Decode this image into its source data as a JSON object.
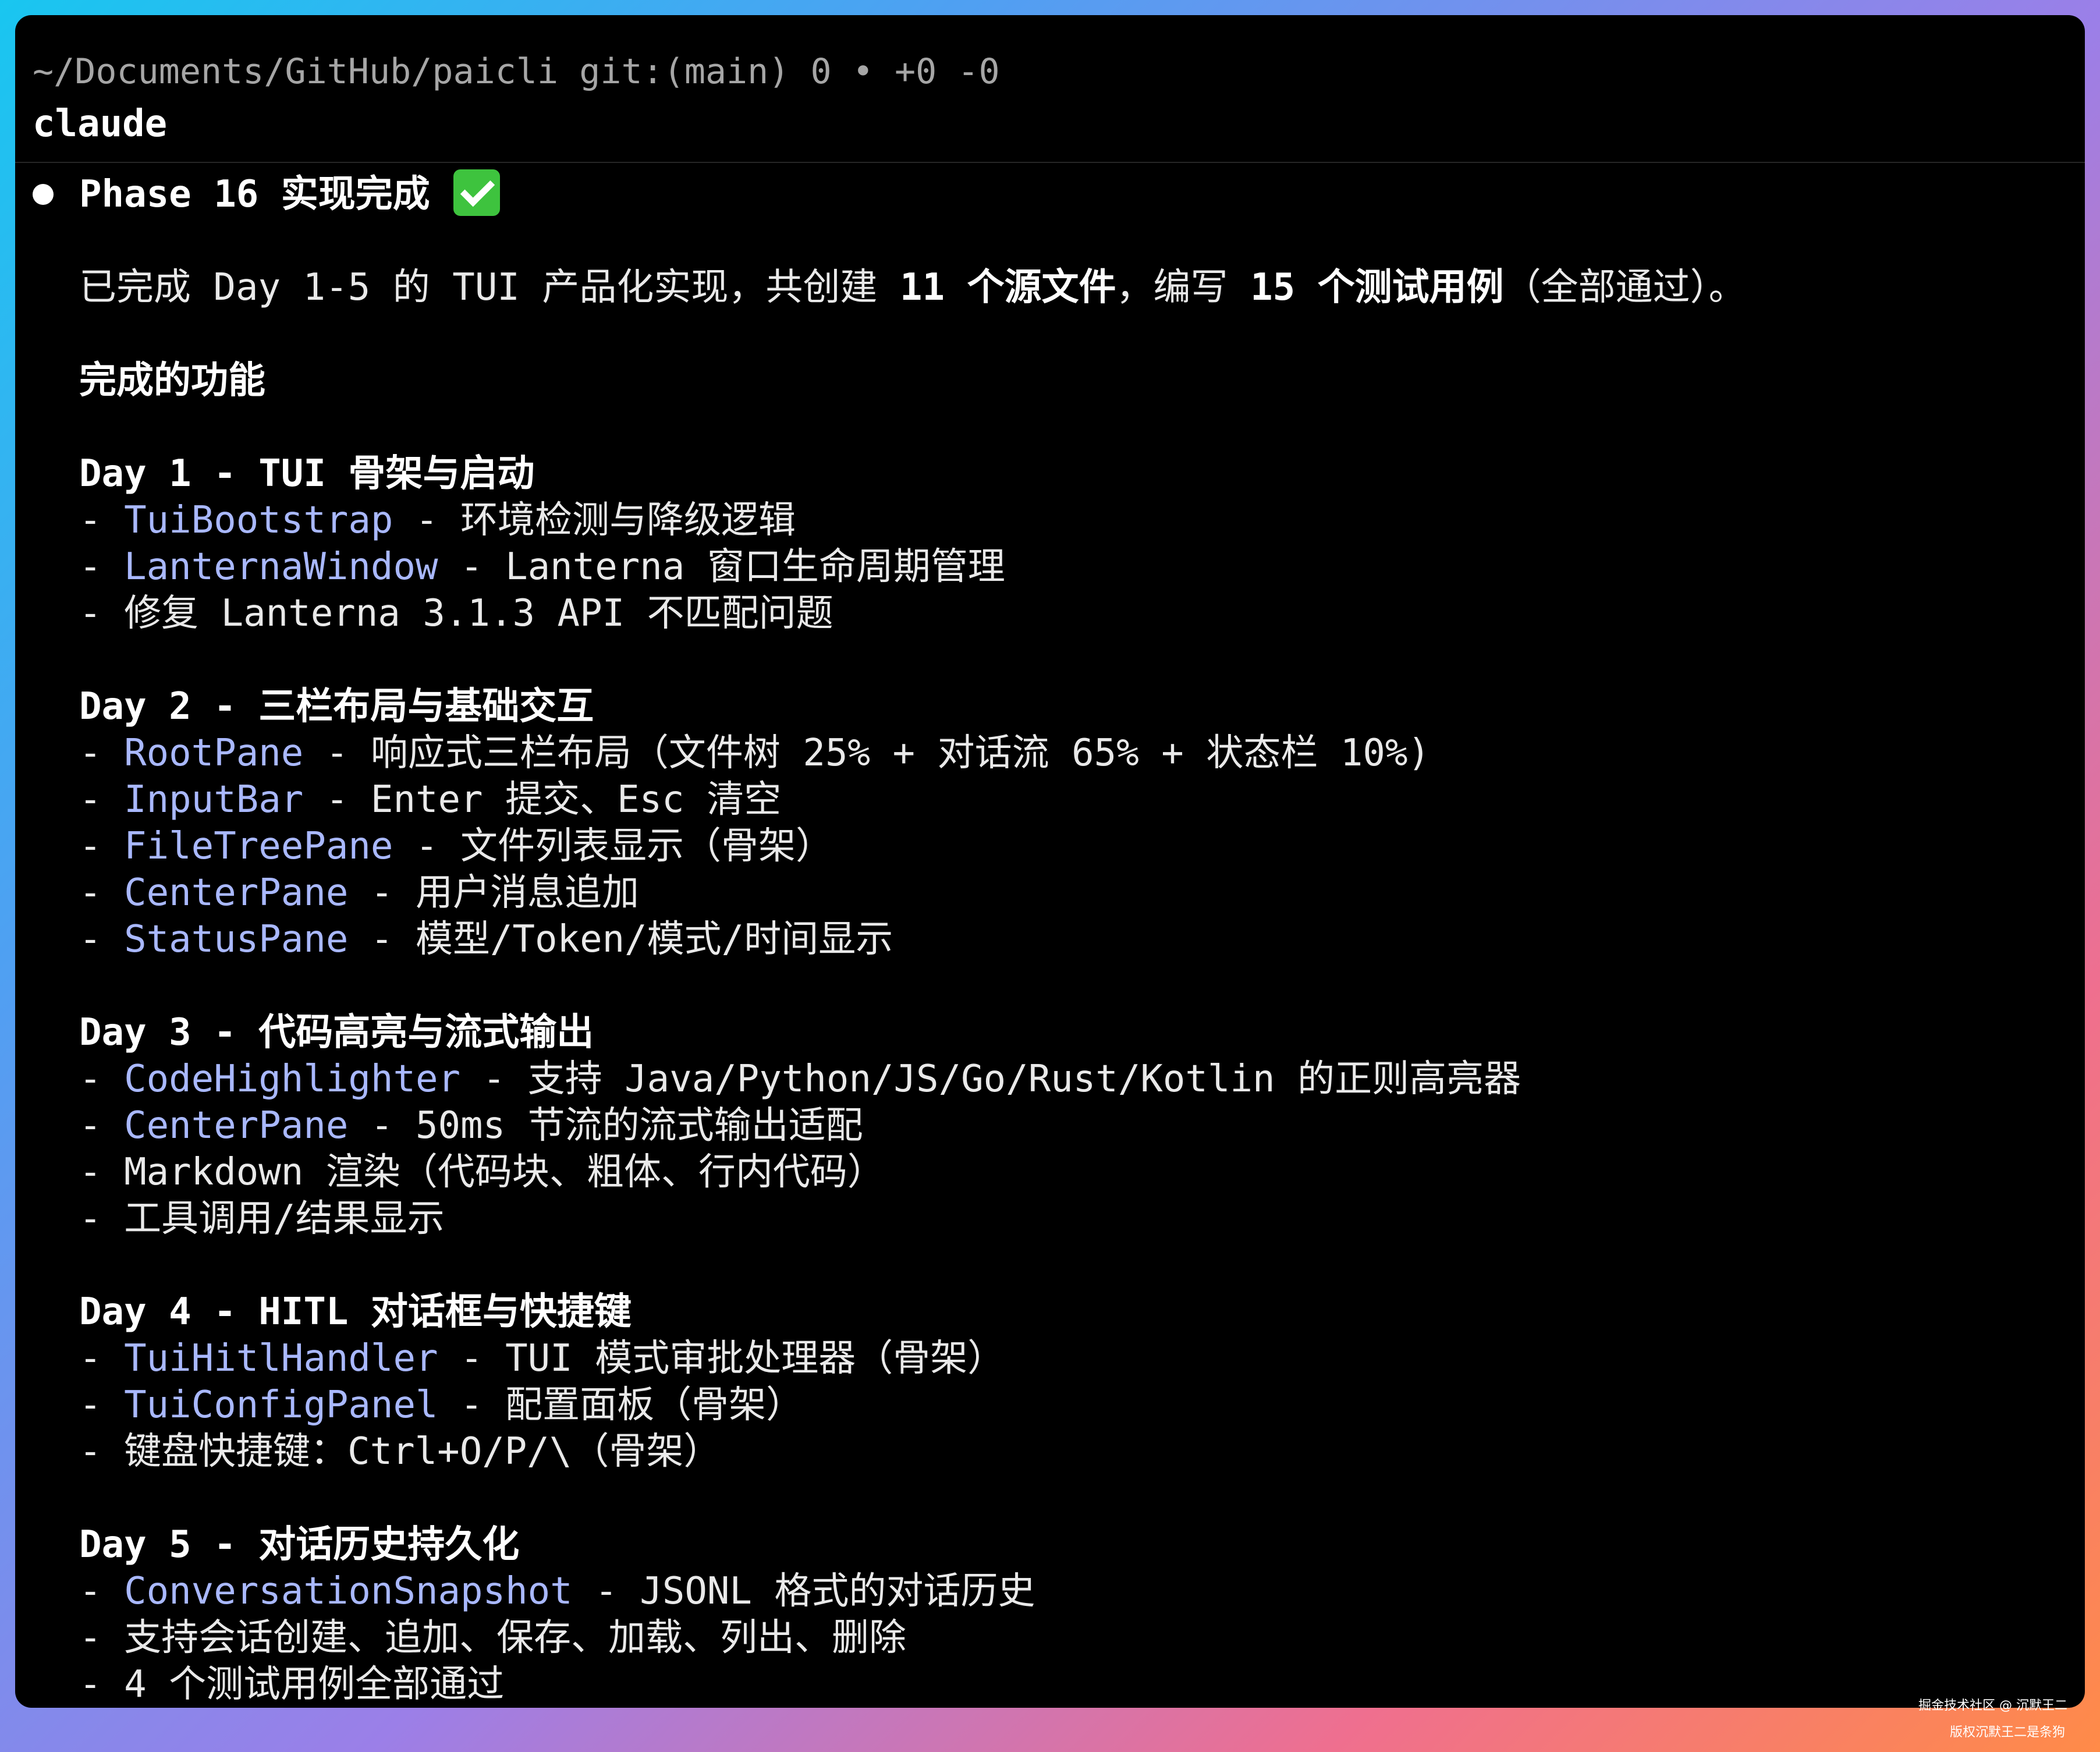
{
  "titlebar": {
    "path": "~/Documents/GitHub/paicli git:(main) 0 • +0 -0",
    "command": "claude"
  },
  "summary": {
    "title": "Phase 16 实现完成",
    "check_icon": "check-mark-button-icon",
    "intro_pre": "已完成 Day 1-5 的 TUI 产品化实现，共创建 ",
    "intro_b1": "11 个源文件",
    "intro_mid": "，编写 ",
    "intro_b2": "15 个测试用例",
    "intro_post": "（全部通过）。",
    "section_heading": "完成的功能"
  },
  "days": [
    {
      "heading": "Day 1 - TUI 骨架与启动",
      "items": [
        {
          "name": "TuiBootstrap",
          "text": " - 环境检测与降级逻辑"
        },
        {
          "name": "LanternaWindow",
          "text": " - Lanterna 窗口生命周期管理"
        },
        {
          "name": "",
          "text": "修复 Lanterna 3.1.3 API 不匹配问题"
        }
      ]
    },
    {
      "heading": "Day 2 - 三栏布局与基础交互",
      "items": [
        {
          "name": "RootPane",
          "text": " - 响应式三栏布局（文件树 25% + 对话流 65% + 状态栏 10%)"
        },
        {
          "name": "InputBar",
          "text": " - Enter 提交、Esc 清空"
        },
        {
          "name": "FileTreePane",
          "text": " - 文件列表显示（骨架）"
        },
        {
          "name": "CenterPane",
          "text": " - 用户消息追加"
        },
        {
          "name": "StatusPane",
          "text": " - 模型/Token/模式/时间显示"
        }
      ]
    },
    {
      "heading": "Day 3 - 代码高亮与流式输出",
      "items": [
        {
          "name": "CodeHighlighter",
          "text": " - 支持 Java/Python/JS/Go/Rust/Kotlin 的正则高亮器"
        },
        {
          "name": "CenterPane",
          "text": " - 50ms 节流的流式输出适配"
        },
        {
          "name": "",
          "text": "Markdown 渲染（代码块、粗体、行内代码）"
        },
        {
          "name": "",
          "text": "工具调用/结果显示"
        }
      ]
    },
    {
      "heading": "Day 4 - HITL 对话框与快捷键",
      "items": [
        {
          "name": "TuiHitlHandler",
          "text": " - TUI 模式审批处理器（骨架）"
        },
        {
          "name": "TuiConfigPanel",
          "text": " - 配置面板（骨架）"
        },
        {
          "name": "",
          "text": "键盘快捷键：Ctrl+O/P/\\（骨架）"
        }
      ]
    },
    {
      "heading": "Day 5 - 对话历史持久化",
      "items": [
        {
          "name": "ConversationSnapshot",
          "text": " - JSONL 格式的对话历史"
        },
        {
          "name": "",
          "text": "支持会话创建、追加、保存、加载、列出、删除"
        },
        {
          "name": "",
          "text": "4 个测试用例全部通过"
        }
      ]
    }
  ],
  "watermark": {
    "line1": "掘金技术社区 @ 沉默王二",
    "line2": "版权沉默王二是条狗"
  }
}
